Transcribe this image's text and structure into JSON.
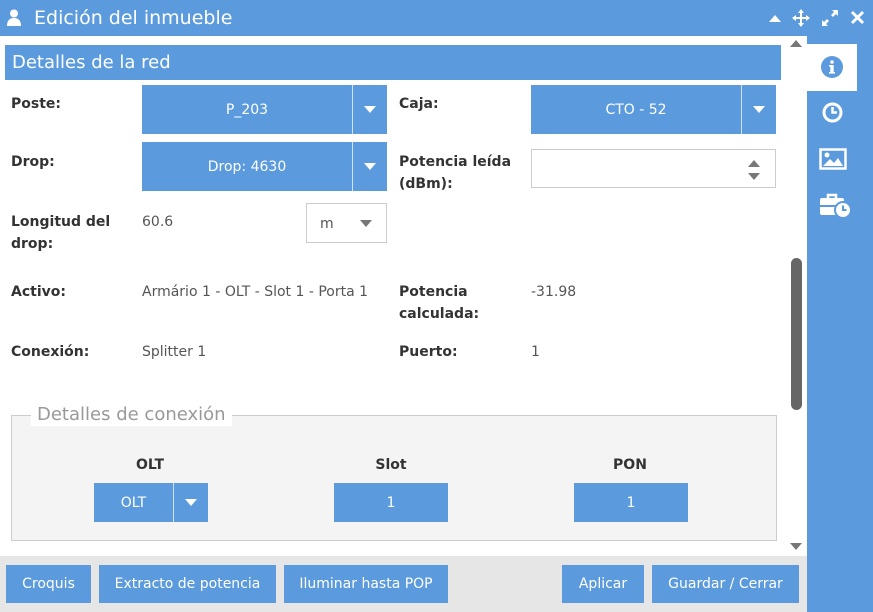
{
  "window": {
    "title": "Edición del inmueble",
    "controls": [
      "collapse-icon",
      "move-icon",
      "maximize-icon",
      "close-icon"
    ]
  },
  "section": {
    "title": "Detalles de la red"
  },
  "fields": {
    "poste": {
      "label": "Poste:",
      "value": "P_203"
    },
    "caja": {
      "label": "Caja:",
      "value": "CTO - 52"
    },
    "drop": {
      "label": "Drop:",
      "value": "Drop: 4630"
    },
    "potencia_leida": {
      "label": "Potencia leída (dBm):",
      "value": ""
    },
    "longitud": {
      "label": "Longitud del drop:",
      "value": "60.6",
      "unit": "m"
    },
    "activo": {
      "label": "Activo:",
      "value": "Armário 1 - OLT - Slot 1 - Porta 1"
    },
    "potencia_calculada": {
      "label": "Potencia calculada:",
      "value": "-31.98"
    },
    "conexion": {
      "label": "Conexión:",
      "value": "Splitter 1"
    },
    "puerto": {
      "label": "Puerto:",
      "value": "1"
    }
  },
  "connection": {
    "legend": "Detalles de conexión",
    "olt": {
      "label": "OLT",
      "value": "OLT"
    },
    "slot": {
      "label": "Slot",
      "value": "1"
    },
    "pon": {
      "label": "PON",
      "value": "1"
    }
  },
  "footer": {
    "croquis": "Croquis",
    "extracto": "Extracto de potencia",
    "iluminar": "Iluminar hasta POP",
    "aplicar": "Aplicar",
    "guardar": "Guardar / Cerrar"
  },
  "sidebar": {
    "items": [
      "info-icon",
      "history-icon",
      "image-icon",
      "briefcase-clock-icon"
    ],
    "active": "info-icon"
  },
  "colors": {
    "accent": "#5b9bdd",
    "panel": "#ffffff",
    "footer": "#e6e6e6"
  }
}
